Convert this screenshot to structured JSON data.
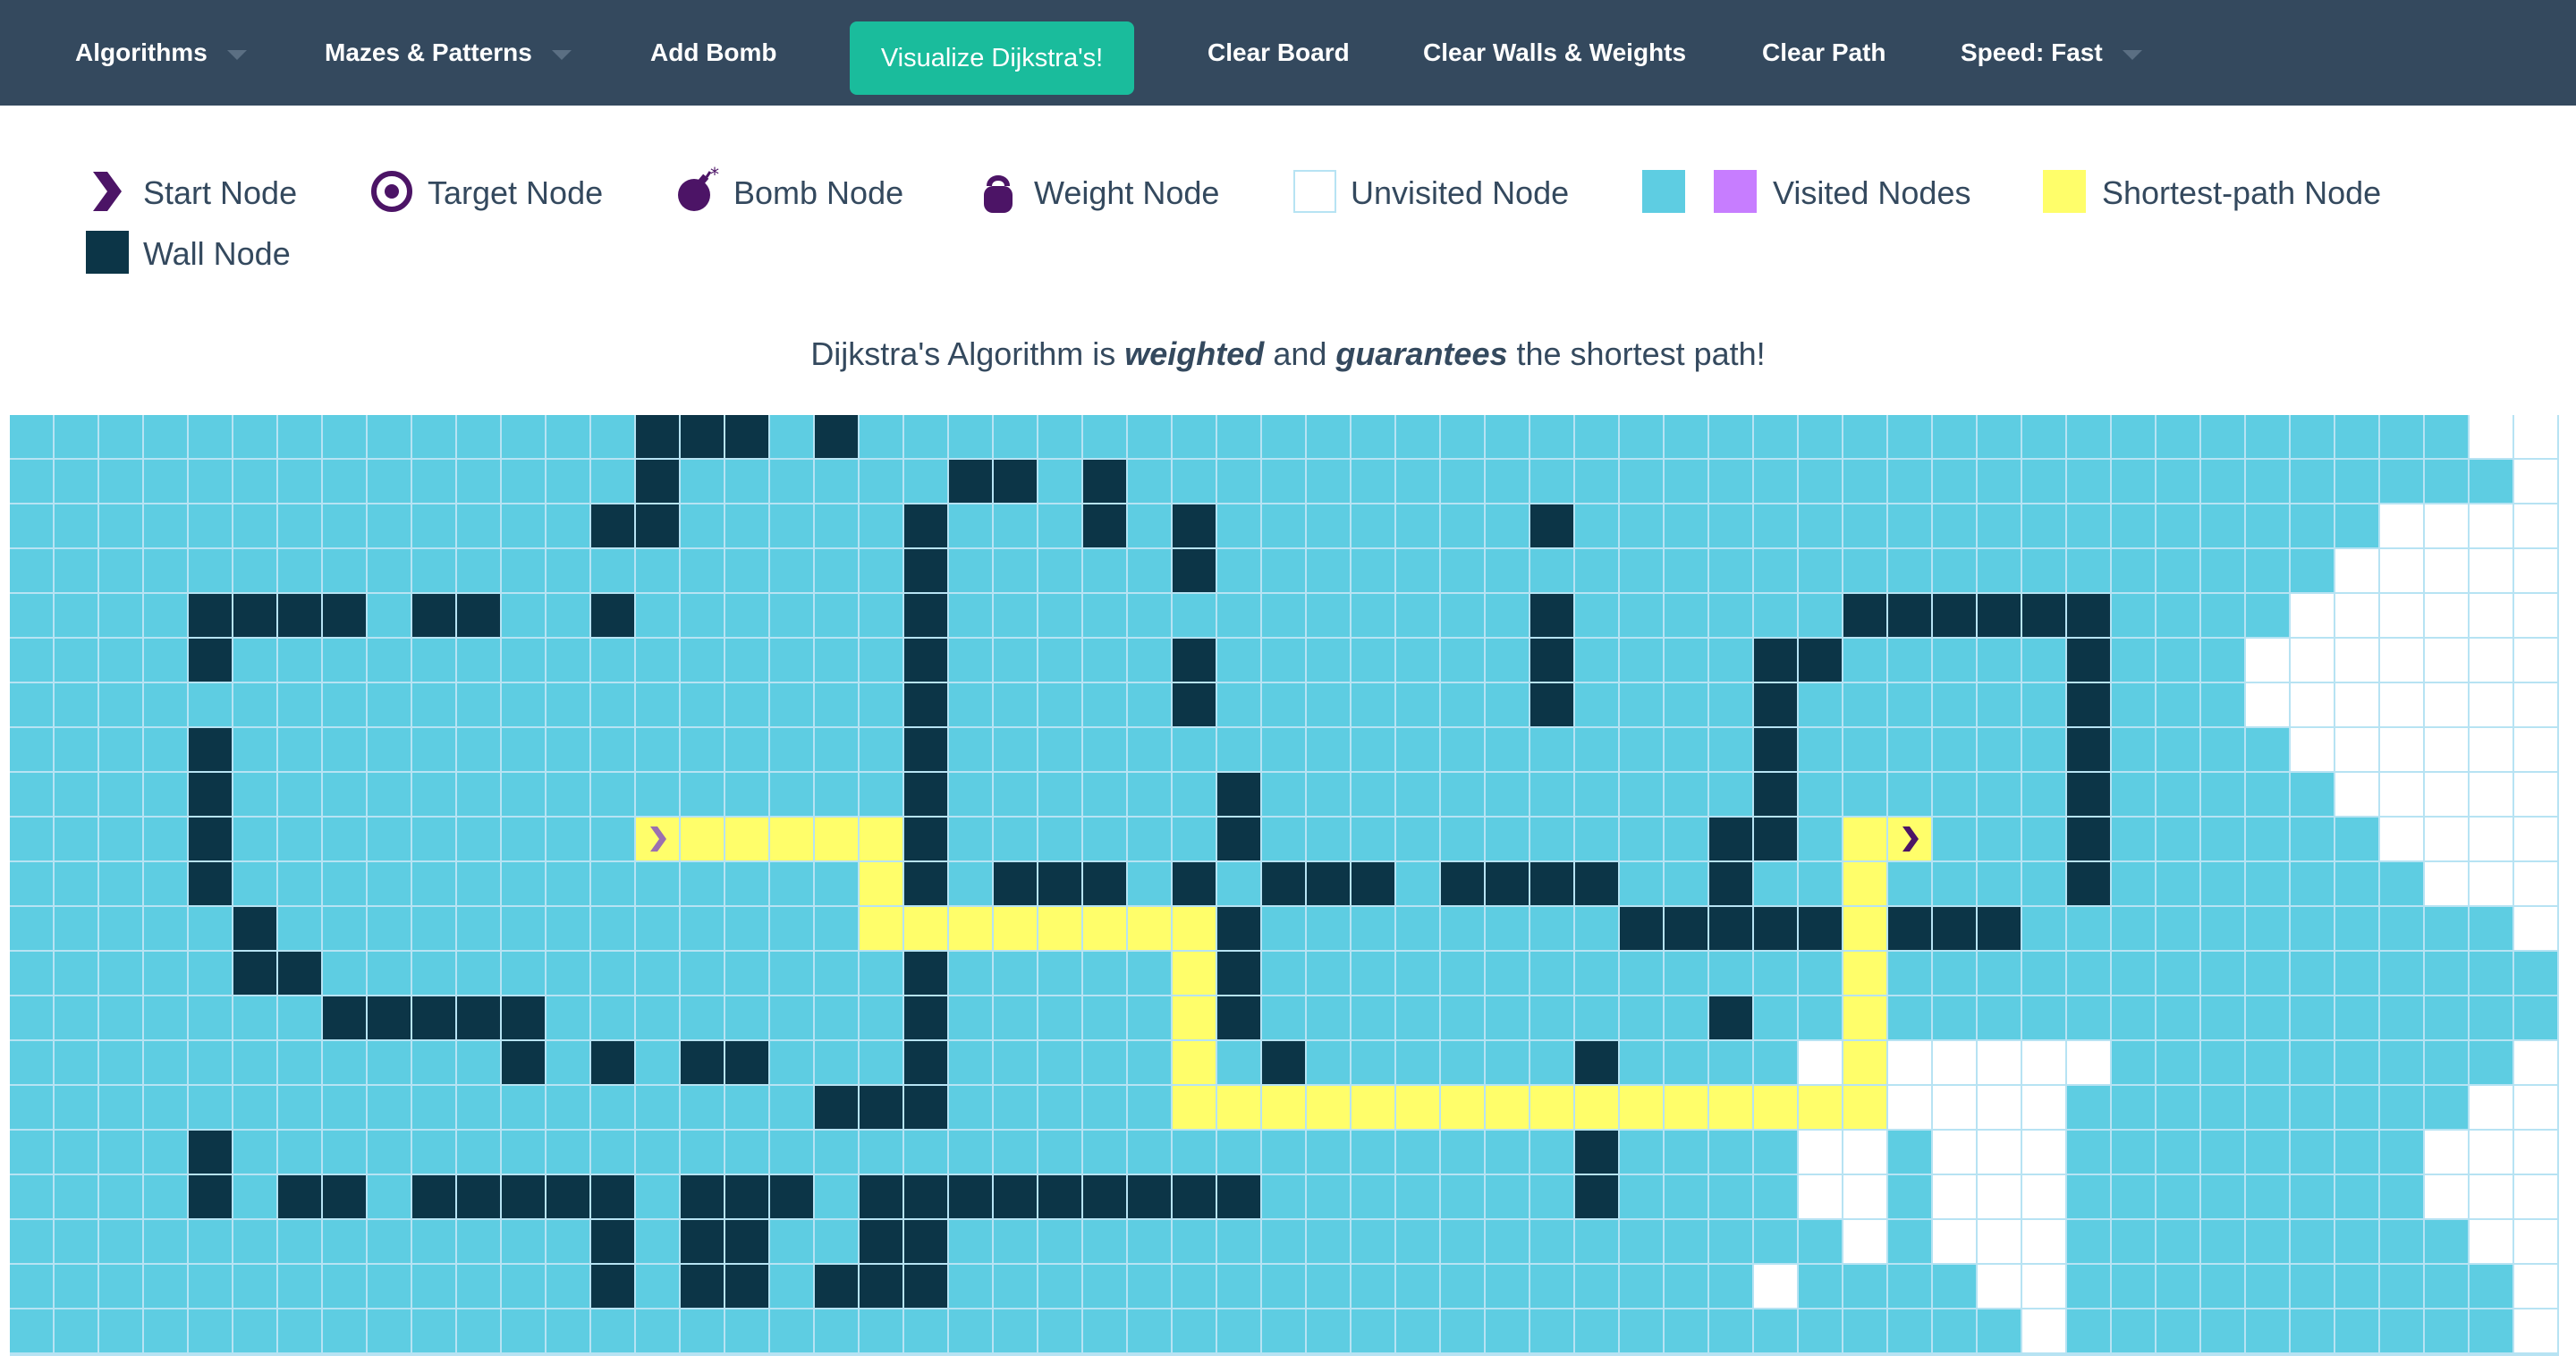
{
  "navbar": {
    "algorithms": "Algorithms",
    "mazes": "Mazes & Patterns",
    "add_bomb": "Add Bomb",
    "visualize": "Visualize Dijkstra's!",
    "clear_board": "Clear Board",
    "clear_walls": "Clear Walls & Weights",
    "clear_path": "Clear Path",
    "speed": "Speed: Fast"
  },
  "legend": {
    "start": "Start Node",
    "target": "Target Node",
    "bomb": "Bomb Node",
    "weight": "Weight Node",
    "unvisited": "Unvisited Node",
    "visited": "Visited Nodes",
    "shortest": "Shortest-path Node",
    "wall": "Wall Node"
  },
  "description": {
    "prefix": "Dijkstra's Algorithm is",
    "weighted": "weighted",
    "and": "and",
    "guarantees": "guarantees",
    "suffix": "the shortest path!"
  },
  "icons": {
    "start": "chevron-right-icon",
    "target": "target-icon",
    "bomb": "bomb-icon",
    "weight": "kettlebell-icon",
    "caret": "caret-down-icon"
  },
  "colors": {
    "navbar": "#34495e",
    "visualize_button": "#1abc9c",
    "visited": "#5ecde2",
    "visited_alt": "#c77dff",
    "wall": "#0c3547",
    "shortest_path": "#fffe6a",
    "unvisited": "#ffffff",
    "grid_line": "#b7e3f3",
    "icon": "#4c1466"
  },
  "grid": {
    "rows": 21,
    "cols": 57,
    "start": [
      10,
      14
    ],
    "target": [
      10,
      42
    ],
    "visited_frontier": [
      55,
      56,
      53,
      52,
      51,
      50,
      50,
      51,
      52,
      53,
      54,
      56,
      57,
      57,
      56,
      55,
      54,
      54,
      55,
      56,
      56
    ],
    "unvisited_pockets": [
      [
        15,
        40,
        46
      ],
      [
        16,
        40,
        45
      ],
      [
        17,
        40,
        41
      ],
      [
        17,
        43,
        45
      ],
      [
        18,
        40,
        41
      ],
      [
        18,
        43,
        45
      ],
      [
        19,
        41,
        41
      ],
      [
        19,
        43,
        45
      ],
      [
        20,
        39,
        39
      ],
      [
        20,
        43,
        45
      ],
      [
        21,
        45,
        45
      ]
    ],
    "visited_pockets": [
      [
        17,
        42,
        42
      ],
      [
        18,
        42,
        42
      ],
      [
        19,
        42,
        42
      ],
      [
        20,
        40,
        41
      ],
      [
        20,
        43,
        43
      ]
    ],
    "walls": [
      [
        1,
        14,
        16
      ],
      [
        1,
        18,
        18
      ],
      [
        2,
        14,
        14
      ],
      [
        2,
        21,
        22
      ],
      [
        2,
        24,
        24
      ],
      [
        3,
        13,
        14
      ],
      [
        3,
        20,
        20
      ],
      [
        3,
        24,
        24
      ],
      [
        3,
        26,
        26
      ],
      [
        3,
        34,
        34
      ],
      [
        4,
        20,
        20
      ],
      [
        4,
        26,
        26
      ],
      [
        5,
        4,
        7
      ],
      [
        5,
        9,
        10
      ],
      [
        5,
        13,
        13
      ],
      [
        5,
        20,
        20
      ],
      [
        5,
        34,
        34
      ],
      [
        5,
        41,
        46
      ],
      [
        6,
        4,
        4
      ],
      [
        6,
        20,
        20
      ],
      [
        6,
        26,
        26
      ],
      [
        6,
        34,
        34
      ],
      [
        6,
        39,
        40
      ],
      [
        6,
        46,
        46
      ],
      [
        7,
        20,
        20
      ],
      [
        7,
        26,
        26
      ],
      [
        7,
        34,
        34
      ],
      [
        7,
        39,
        39
      ],
      [
        7,
        46,
        46
      ],
      [
        8,
        4,
        4
      ],
      [
        8,
        20,
        20
      ],
      [
        8,
        39,
        39
      ],
      [
        8,
        46,
        46
      ],
      [
        9,
        4,
        4
      ],
      [
        9,
        20,
        20
      ],
      [
        9,
        27,
        27
      ],
      [
        9,
        39,
        39
      ],
      [
        9,
        46,
        46
      ],
      [
        10,
        4,
        4
      ],
      [
        10,
        20,
        20
      ],
      [
        10,
        27,
        27
      ],
      [
        10,
        38,
        39
      ],
      [
        10,
        46,
        46
      ],
      [
        11,
        4,
        4
      ],
      [
        11,
        20,
        20
      ],
      [
        11,
        22,
        24
      ],
      [
        11,
        26,
        26
      ],
      [
        11,
        28,
        30
      ],
      [
        11,
        32,
        35
      ],
      [
        11,
        38,
        38
      ],
      [
        11,
        46,
        46
      ],
      [
        12,
        5,
        5
      ],
      [
        12,
        27,
        27
      ],
      [
        12,
        36,
        40
      ],
      [
        12,
        42,
        44
      ],
      [
        13,
        5,
        6
      ],
      [
        13,
        20,
        20
      ],
      [
        13,
        27,
        27
      ],
      [
        14,
        7,
        11
      ],
      [
        14,
        20,
        20
      ],
      [
        14,
        27,
        27
      ],
      [
        14,
        38,
        38
      ],
      [
        15,
        11,
        11
      ],
      [
        15,
        13,
        13
      ],
      [
        15,
        15,
        16
      ],
      [
        15,
        20,
        20
      ],
      [
        15,
        28,
        28
      ],
      [
        15,
        35,
        35
      ],
      [
        16,
        18,
        20
      ],
      [
        17,
        4,
        4
      ],
      [
        17,
        35,
        35
      ],
      [
        18,
        4,
        4
      ],
      [
        18,
        6,
        7
      ],
      [
        18,
        9,
        13
      ],
      [
        18,
        15,
        17
      ],
      [
        18,
        19,
        27
      ],
      [
        18,
        35,
        35
      ],
      [
        19,
        13,
        13
      ],
      [
        19,
        15,
        16
      ],
      [
        19,
        19,
        20
      ],
      [
        20,
        13,
        13
      ],
      [
        20,
        15,
        16
      ],
      [
        20,
        18,
        20
      ]
    ],
    "path": [
      [
        10,
        15
      ],
      [
        10,
        16
      ],
      [
        10,
        17
      ],
      [
        10,
        18
      ],
      [
        10,
        19
      ],
      [
        11,
        19
      ],
      [
        12,
        19
      ],
      [
        12,
        20
      ],
      [
        12,
        21
      ],
      [
        12,
        22
      ],
      [
        12,
        23
      ],
      [
        12,
        24
      ],
      [
        12,
        25
      ],
      [
        12,
        26
      ],
      [
        13,
        26
      ],
      [
        14,
        26
      ],
      [
        15,
        26
      ],
      [
        16,
        26
      ],
      [
        16,
        27
      ],
      [
        16,
        28
      ],
      [
        16,
        29
      ],
      [
        16,
        30
      ],
      [
        16,
        31
      ],
      [
        16,
        32
      ],
      [
        16,
        33
      ],
      [
        16,
        34
      ],
      [
        16,
        35
      ],
      [
        16,
        36
      ],
      [
        16,
        37
      ],
      [
        16,
        38
      ],
      [
        16,
        39
      ],
      [
        16,
        40
      ],
      [
        16,
        41
      ],
      [
        15,
        41
      ],
      [
        14,
        41
      ],
      [
        13,
        41
      ],
      [
        12,
        41
      ],
      [
        11,
        41
      ],
      [
        10,
        41
      ]
    ]
  }
}
